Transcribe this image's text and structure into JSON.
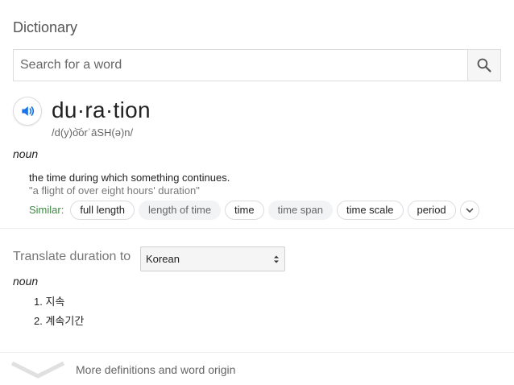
{
  "header": {
    "title": "Dictionary"
  },
  "search": {
    "placeholder": "Search for a word",
    "value": ""
  },
  "entry": {
    "word": "du·ra·tion",
    "phonetic": "/d(y)o͝orˈāSH(ə)n/",
    "part_of_speech": "noun",
    "definition": "the time during which something continues.",
    "example": "\"a flight of over eight hours' duration\"",
    "similar_label": "Similar:",
    "similar": [
      {
        "label": "full length",
        "style": "outline"
      },
      {
        "label": "length of time",
        "style": "filled"
      },
      {
        "label": "time",
        "style": "outline"
      },
      {
        "label": "time span",
        "style": "filled"
      },
      {
        "label": "time scale",
        "style": "outline"
      },
      {
        "label": "period",
        "style": "outline"
      }
    ]
  },
  "translate": {
    "label": "Translate duration to",
    "selected_language": "Korean",
    "part_of_speech": "noun",
    "items": [
      "1. 지속",
      "2. 계속기간"
    ]
  },
  "footer": {
    "more_label": "More definitions and word origin"
  },
  "colors": {
    "accent_blue": "#1a73e8",
    "similar_green": "#3e8a42",
    "divider": "#ececec"
  },
  "icons": {
    "search": "search-icon",
    "speaker": "speaker-icon",
    "expand": "chevron-down-icon",
    "select": "select-arrows-icon",
    "more": "chevron-down-icon"
  }
}
